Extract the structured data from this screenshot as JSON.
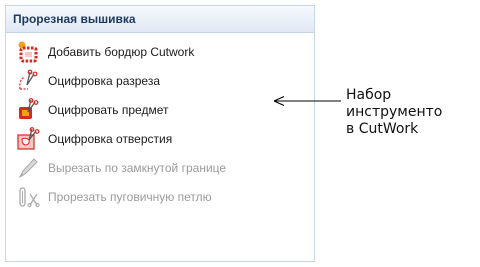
{
  "panel": {
    "title": "Прорезная вышивка",
    "items": [
      {
        "label": "Добавить бордюр  Cutwork",
        "icon": "add-cutwork-border-icon",
        "enabled": true
      },
      {
        "label": "Оцифровка разреза",
        "icon": "digitize-cut-icon",
        "enabled": true
      },
      {
        "label": "Оцифровать предмет",
        "icon": "digitize-object-icon",
        "enabled": true
      },
      {
        "label": "Оцифровка отверстия",
        "icon": "digitize-hole-icon",
        "enabled": true
      },
      {
        "label": "Вырезать по замкнутой границе",
        "icon": "cut-closed-boundary-icon",
        "enabled": false
      },
      {
        "label": "Прорезать пуговичную петлю",
        "icon": "cut-buttonhole-icon",
        "enabled": false
      }
    ]
  },
  "callout": {
    "text": "Набор\nинструменто\nв CutWork"
  },
  "colors": {
    "header_bg": "#dfe8f4",
    "header_text": "#1e3a5f",
    "disabled_text": "#9b9b9b",
    "icon_red": "#d42a20",
    "icon_orange": "#f4a21c"
  }
}
